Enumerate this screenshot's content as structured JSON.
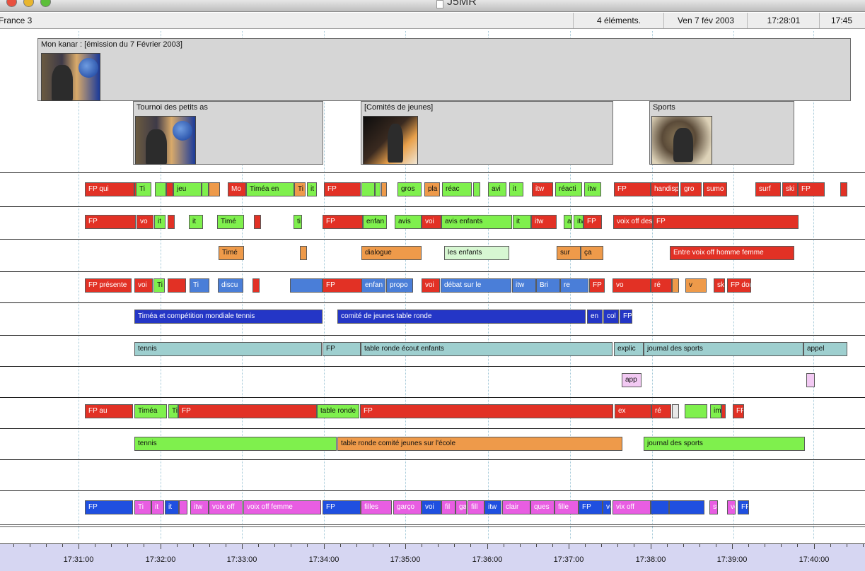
{
  "window": {
    "title": "J5MR",
    "channel": "France 3",
    "element_count": "4 éléments.",
    "date": "Ven 7 fév 2003",
    "current_time": "17:28:01",
    "end_time": "17:45"
  },
  "segments": {
    "main": "Mon kanar : [émission du 7 Février 2003]",
    "sub1": "Tournoi des petits as",
    "sub2": "[Comités de jeunes]",
    "sub3": "Sports"
  },
  "tracks": [
    [
      {
        "l": "FP qui",
        "c": "red"
      },
      {
        "l": "",
        "c": "red"
      },
      {
        "l": "Ti",
        "c": "green"
      },
      {
        "l": "",
        "c": "green"
      },
      {
        "l": "",
        "c": "red"
      },
      {
        "l": "jeu",
        "c": "green"
      },
      {
        "l": "",
        "c": "green"
      },
      {
        "l": "",
        "c": "orange"
      },
      {
        "l": "Mo",
        "c": "red"
      },
      {
        "l": "Timéa en",
        "c": "green"
      },
      {
        "l": "Ti",
        "c": "orange"
      },
      {
        "l": "it",
        "c": "green"
      },
      {
        "l": "FP",
        "c": "red"
      },
      {
        "l": "",
        "c": "green"
      },
      {
        "l": "",
        "c": "green"
      },
      {
        "l": "",
        "c": "orange"
      },
      {
        "l": "gros",
        "c": "green"
      },
      {
        "l": "pla",
        "c": "orange"
      },
      {
        "l": "réac",
        "c": "green"
      },
      {
        "l": "",
        "c": "green"
      },
      {
        "l": "avi",
        "c": "green"
      },
      {
        "l": "it",
        "c": "green"
      },
      {
        "l": "itw",
        "c": "red"
      },
      {
        "l": "réacti",
        "c": "green"
      },
      {
        "l": "itw",
        "c": "green"
      },
      {
        "l": "FP",
        "c": "red"
      },
      {
        "l": "handisp",
        "c": "red"
      },
      {
        "l": "gro",
        "c": "red"
      },
      {
        "l": "sumo",
        "c": "red"
      },
      {
        "l": "surf",
        "c": "red"
      },
      {
        "l": "ski",
        "c": "red"
      },
      {
        "l": "FP",
        "c": "red"
      },
      {
        "l": "",
        "c": "red"
      }
    ],
    [
      {
        "l": "FP",
        "c": "red"
      },
      {
        "l": "vo",
        "c": "red"
      },
      {
        "l": "it",
        "c": "green"
      },
      {
        "l": "",
        "c": "red"
      },
      {
        "l": "it",
        "c": "green"
      },
      {
        "l": "Timé",
        "c": "green"
      },
      {
        "l": "",
        "c": "red"
      },
      {
        "l": "ti",
        "c": "green"
      },
      {
        "l": "FP",
        "c": "red"
      },
      {
        "l": "",
        "c": "green"
      },
      {
        "l": "enfan",
        "c": "green"
      },
      {
        "l": "avis",
        "c": "green"
      },
      {
        "l": "voi",
        "c": "red"
      },
      {
        "l": "avis enfants",
        "c": "green"
      },
      {
        "l": "it",
        "c": "green"
      },
      {
        "l": "itw",
        "c": "red"
      },
      {
        "l": "a",
        "c": "green"
      },
      {
        "l": "itw",
        "c": "green"
      },
      {
        "l": "FP",
        "c": "red"
      },
      {
        "l": "voix off des adultes",
        "c": "red"
      },
      {
        "l": "FP",
        "c": "red"
      }
    ],
    [
      {
        "l": "Timé",
        "c": "orange"
      },
      {
        "l": "",
        "c": "orange"
      },
      {
        "l": "dialogue",
        "c": "orange"
      },
      {
        "l": "les enfants",
        "c": "lgreen"
      },
      {
        "l": "sur",
        "c": "orange"
      },
      {
        "l": "ça",
        "c": "orange"
      },
      {
        "l": "Entre voix off homme femme",
        "c": "red"
      }
    ],
    [
      {
        "l": "FP présente",
        "c": "red"
      },
      {
        "l": "voi",
        "c": "red"
      },
      {
        "l": "Ti",
        "c": "green"
      },
      {
        "l": "",
        "c": "red"
      },
      {
        "l": "Ti",
        "c": "mblue"
      },
      {
        "l": "discu",
        "c": "mblue"
      },
      {
        "l": "",
        "c": "red"
      },
      {
        "l": "",
        "c": "mblue"
      },
      {
        "l": "FP",
        "c": "red"
      },
      {
        "l": "enfan",
        "c": "mblue"
      },
      {
        "l": "propo",
        "c": "mblue"
      },
      {
        "l": "voi",
        "c": "red"
      },
      {
        "l": "débat sur le",
        "c": "mblue"
      },
      {
        "l": "itw",
        "c": "mblue"
      },
      {
        "l": "Bri",
        "c": "mblue"
      },
      {
        "l": "re",
        "c": "mblue"
      },
      {
        "l": "FP",
        "c": "red"
      },
      {
        "l": "vo",
        "c": "red"
      },
      {
        "l": "ré",
        "c": "red"
      },
      {
        "l": "",
        "c": "orange"
      },
      {
        "l": "v",
        "c": "orange"
      },
      {
        "l": "ski",
        "c": "red"
      },
      {
        "l": "FP donne les",
        "c": "red"
      }
    ],
    [
      {
        "l": "Timéa et compétition mondiale tennis",
        "c": "dblue"
      },
      {
        "l": "comité de jeunes table ronde",
        "c": "dblue"
      },
      {
        "l": "en",
        "c": "dblue"
      },
      {
        "l": "col",
        "c": "dblue"
      },
      {
        "l": "FP",
        "c": "dblue"
      }
    ],
    [
      {
        "l": "tennis",
        "c": "teal"
      },
      {
        "l": "FP",
        "c": "teal"
      },
      {
        "l": "table ronde écout enfants",
        "c": "teal"
      },
      {
        "l": "explic",
        "c": "teal"
      },
      {
        "l": "journal des sports",
        "c": "teal"
      },
      {
        "l": "appel",
        "c": "teal"
      }
    ],
    [
      {
        "l": "app",
        "c": "lpink"
      },
      {
        "l": "",
        "c": "lpink"
      }
    ],
    [
      {
        "l": "FP au",
        "c": "red"
      },
      {
        "l": "Timéa",
        "c": "green"
      },
      {
        "l": "Timéa en compétition",
        "c": "green"
      },
      {
        "l": "FP",
        "c": "red"
      },
      {
        "l": "table ronde",
        "c": "green"
      },
      {
        "l": "FP",
        "c": "red"
      },
      {
        "l": "ex",
        "c": "red"
      },
      {
        "l": "ré",
        "c": "red"
      },
      {
        "l": "",
        "c": "gray"
      },
      {
        "l": "",
        "c": "green"
      },
      {
        "l": "images",
        "c": "green"
      },
      {
        "l": "FP",
        "c": "red"
      },
      {
        "l": "FP",
        "c": "red"
      }
    ],
    [
      {
        "l": "tennis",
        "c": "green"
      },
      {
        "l": "table ronde comité jeunes sur l'école",
        "c": "orange"
      },
      {
        "l": "journal des sports",
        "c": "green"
      }
    ],
    [],
    [
      {
        "l": "FP",
        "c": "blue"
      },
      {
        "l": "Ti",
        "c": "pink"
      },
      {
        "l": "it",
        "c": "pink"
      },
      {
        "l": "it",
        "c": "blue"
      },
      {
        "l": "",
        "c": "pink"
      },
      {
        "l": "itw",
        "c": "pink"
      },
      {
        "l": "voix off",
        "c": "pink"
      },
      {
        "l": "voix off femme",
        "c": "pink"
      },
      {
        "l": "FP",
        "c": "blue"
      },
      {
        "l": "filles",
        "c": "pink"
      },
      {
        "l": "garço",
        "c": "pink"
      },
      {
        "l": "voi",
        "c": "blue"
      },
      {
        "l": "fil",
        "c": "pink"
      },
      {
        "l": "gar",
        "c": "pink"
      },
      {
        "l": "fill",
        "c": "pink"
      },
      {
        "l": "itw",
        "c": "blue"
      },
      {
        "l": "clair",
        "c": "pink"
      },
      {
        "l": "ques",
        "c": "pink"
      },
      {
        "l": "fille",
        "c": "pink"
      },
      {
        "l": "FP",
        "c": "blue"
      },
      {
        "l": "voi",
        "c": "blue"
      },
      {
        "l": "vix off",
        "c": "pink"
      },
      {
        "l": "",
        "c": "blue"
      },
      {
        "l": "",
        "c": "blue"
      },
      {
        "l": "su",
        "c": "pink"
      },
      {
        "l": "vo",
        "c": "pink"
      },
      {
        "l": "FP",
        "c": "blue"
      }
    ]
  ],
  "ruler": {
    "labels": [
      "17:31:00",
      "17:32:00",
      "17:33:00",
      "17:34:00",
      "17:35:00",
      "17:36:00",
      "17:37:00",
      "17:38:00",
      "17:39:00",
      "17:40:00"
    ]
  }
}
